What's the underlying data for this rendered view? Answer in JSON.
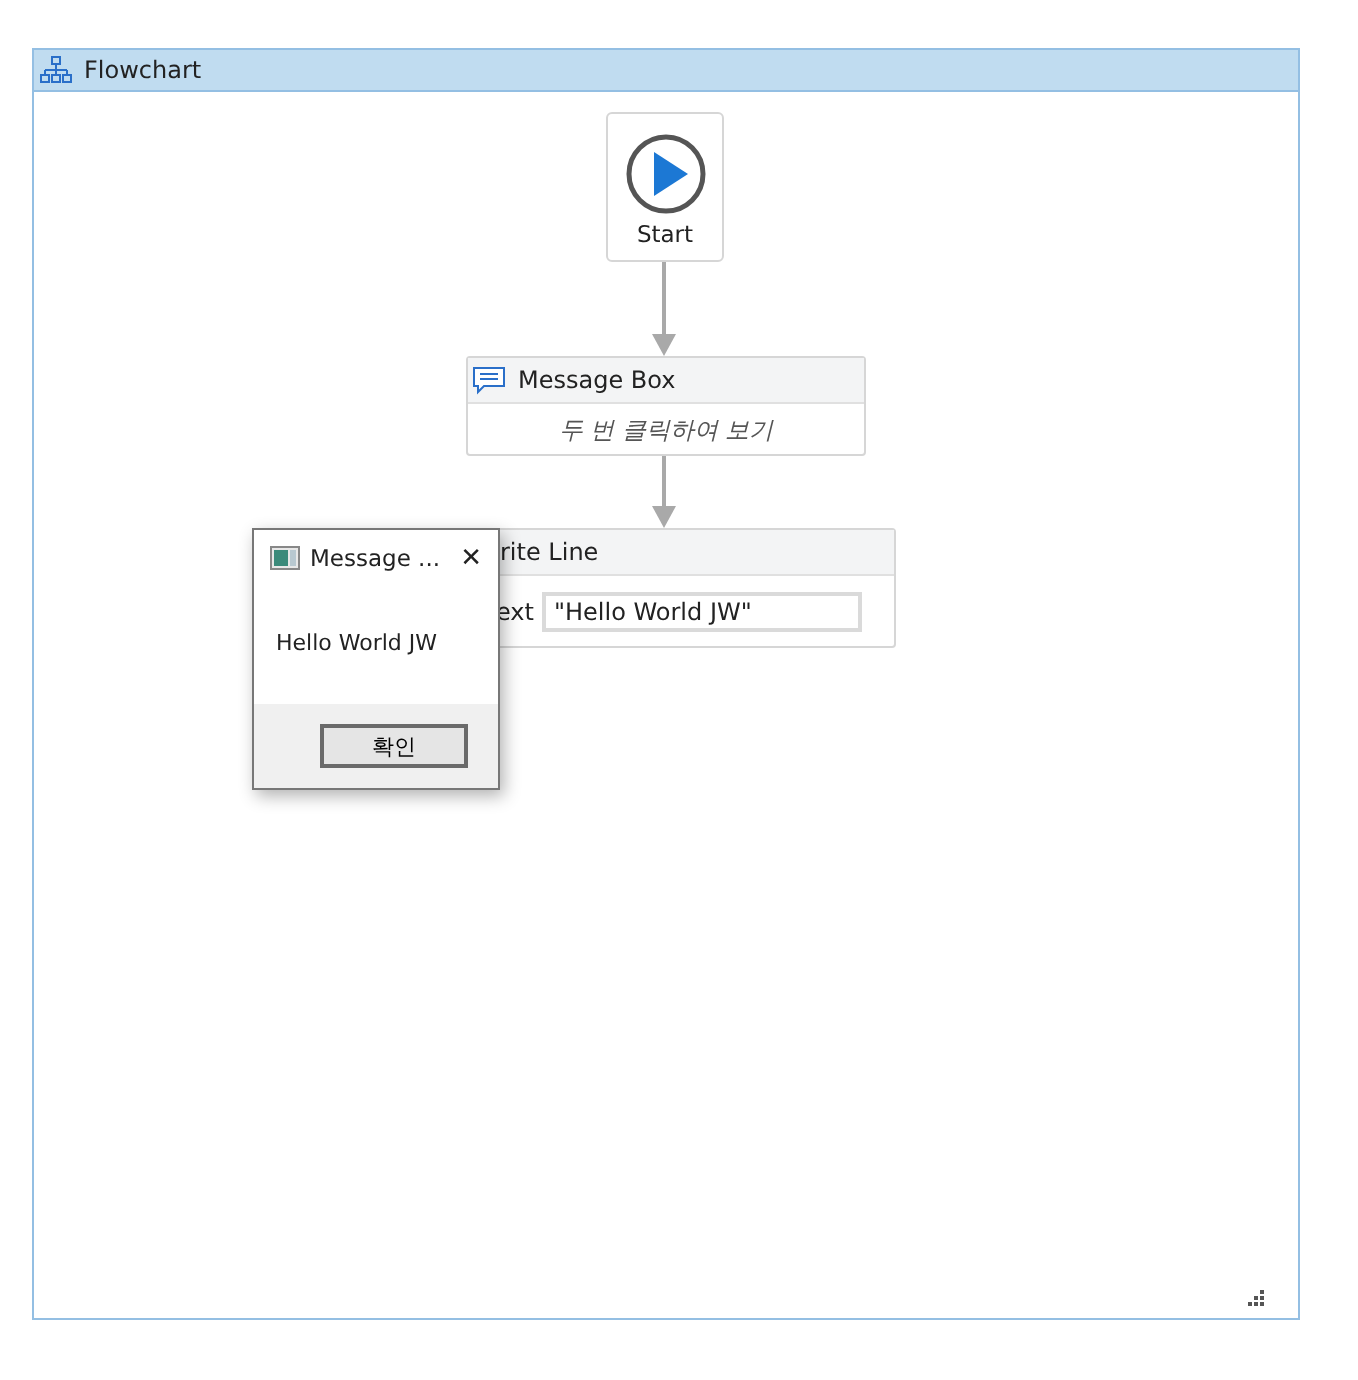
{
  "panel": {
    "title": "Flowchart"
  },
  "nodes": [
    {
      "kind": "start",
      "label": "Start"
    },
    {
      "kind": "activity",
      "title": "Message Box",
      "hint": "두 번 클릭하여 보기"
    },
    {
      "kind": "field",
      "title": "rite Line",
      "field_label": "ext",
      "value": "\"Hello World JW\""
    }
  ],
  "dialog": {
    "title": "Message ...",
    "close": "✕",
    "message": "Hello World JW",
    "button": "확인"
  }
}
